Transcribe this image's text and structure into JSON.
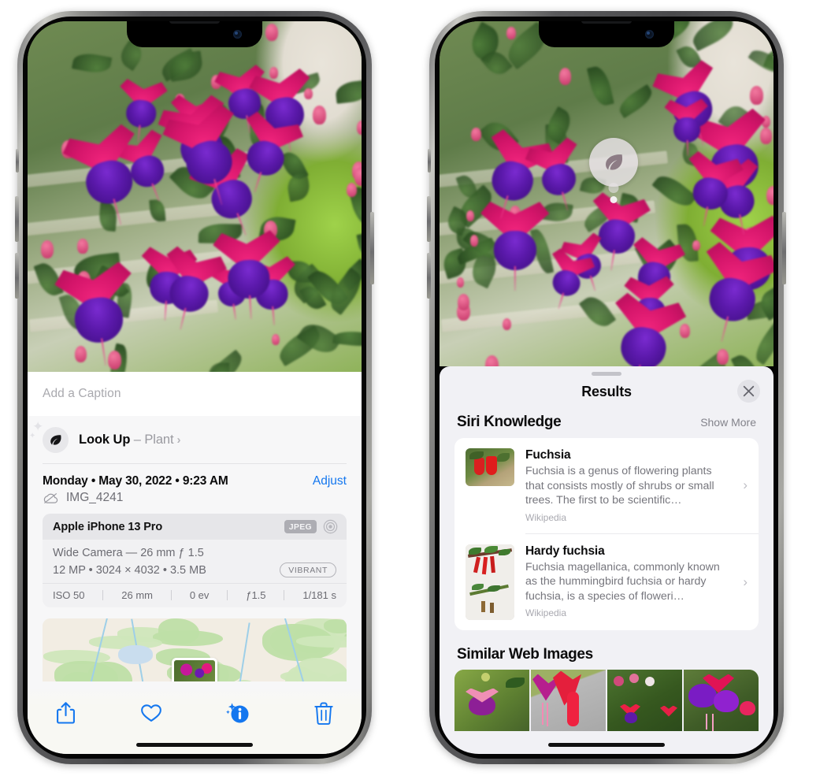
{
  "left_phone": {
    "caption_placeholder": "Add a Caption",
    "lookup": {
      "label": "Look Up",
      "dash": " – ",
      "subject": "Plant",
      "chevron": "›",
      "icon": "leaf-icon"
    },
    "date_line": "Monday • May 30, 2022 • 9:23 AM",
    "adjust_label": "Adjust",
    "filename": "IMG_4241",
    "cloud_icon": "icloud-slash-icon",
    "camera_card": {
      "device": "Apple iPhone 13 Pro",
      "format_badge": "JPEG",
      "raw_icon": "hdr-circle-icon",
      "lens_line": "Wide Camera — 26 mm ƒ 1.5",
      "size_line": "12 MP • 3024 × 4032 • 3.5 MB",
      "style_badge": "VIBRANT",
      "exif": [
        "ISO 50",
        "26 mm",
        "0 ev",
        "ƒ1.5",
        "1/181 s"
      ]
    },
    "toolbar": [
      {
        "name": "share-button",
        "icon": "share-icon"
      },
      {
        "name": "favorite-button",
        "icon": "heart-icon"
      },
      {
        "name": "info-button",
        "icon": "info-sparkle-icon"
      },
      {
        "name": "delete-button",
        "icon": "trash-icon"
      }
    ]
  },
  "right_phone": {
    "visual_lookup_badge": "leaf-icon",
    "sheet": {
      "title": "Results",
      "close_label": "×",
      "sections": [
        {
          "title": "Siri Knowledge",
          "action": "Show More",
          "items": [
            {
              "name": "Fuchsia",
              "description": "Fuchsia is a genus of flowering plants that consists mostly of shrubs or small trees. The first to be scientific…",
              "source": "Wikipedia",
              "chevron": "›"
            },
            {
              "name": "Hardy fuchsia",
              "description": "Fuchsia magellanica, commonly known as the hummingbird fuchsia or hardy fuchsia, is a species of floweri…",
              "source": "Wikipedia",
              "chevron": "›"
            }
          ]
        },
        {
          "title": "Similar Web Images",
          "images": [
            "web-image-1",
            "web-image-2",
            "web-image-3",
            "web-image-4"
          ]
        }
      ]
    }
  },
  "colors": {
    "accent_blue": "#1477ef",
    "sheet_bg": "#f1f1f5",
    "info_bg": "#f7f7f8",
    "card_bg": "#f1f1f3",
    "secondary_text": "#76767d"
  }
}
